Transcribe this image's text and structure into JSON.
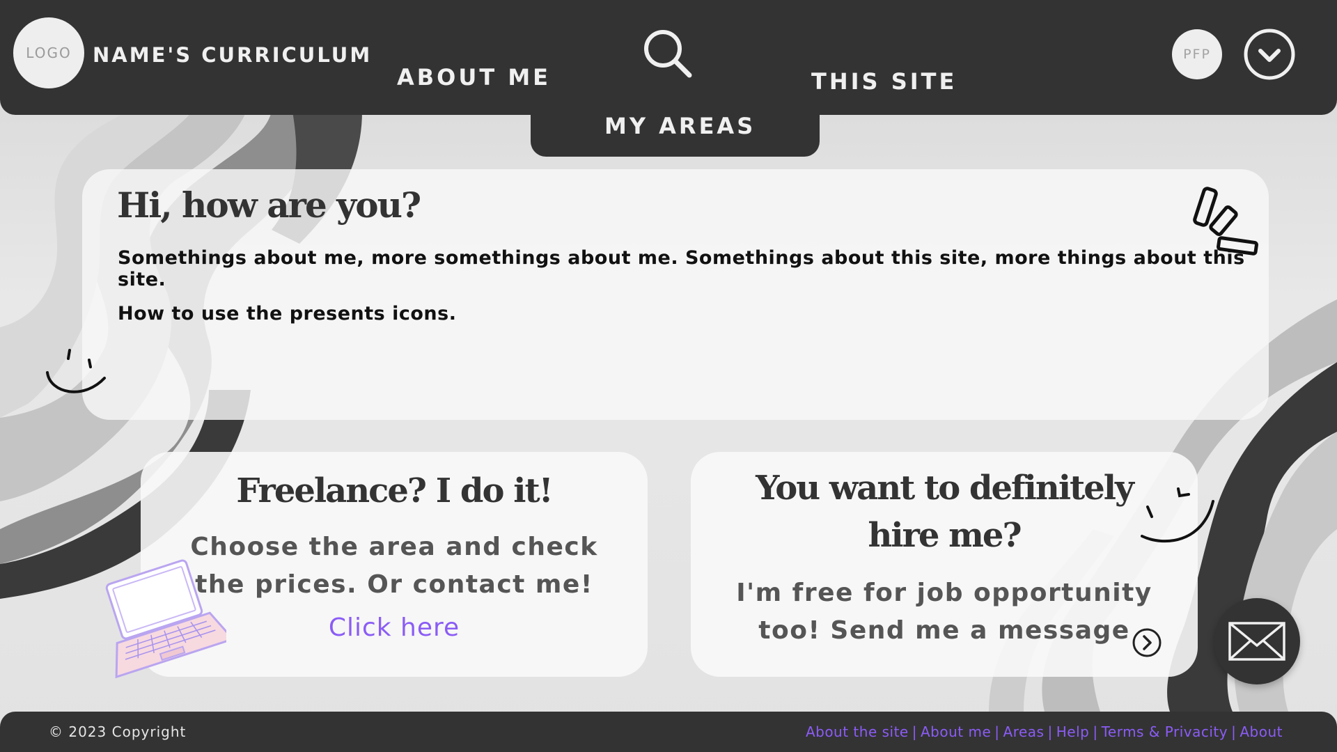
{
  "header": {
    "logo": "LOGO",
    "title": "NAME'S CURRICULUM",
    "nav": [
      "ABOUT ME",
      "MY AREAS",
      "THIS SITE"
    ],
    "pfp": "PFP"
  },
  "intro": {
    "title": "Hi, how are you?",
    "p1": "Somethings about me, more somethings about me. Somethings about this site, more things about this site.",
    "p2": "How to use the presents icons."
  },
  "freelance": {
    "title": "Freelance? I do it!",
    "text_line1": "Choose the area and check",
    "text_line2": "the prices. Or contact me!",
    "link": "Click here"
  },
  "hire": {
    "title_line1": "You want to definitely",
    "title_line2": "hire me?",
    "text_line1": "I'm free for job opportunity",
    "text_line2": "too! Send me a message"
  },
  "footer": {
    "copyright": "© 2023 Copyright",
    "links": [
      "About the site",
      "About me",
      "Areas",
      "Help",
      "Terms & Privacity",
      "About"
    ],
    "separator": "|"
  },
  "icons": {
    "search": "search-icon",
    "menu": "chevron-down-icon",
    "mail": "mail-icon",
    "arrow": "arrow-right-icon",
    "laptop": "laptop-icon"
  },
  "colors": {
    "dark": "#333333",
    "accent": "#8B5CF6",
    "card": "#f8f8f8"
  }
}
